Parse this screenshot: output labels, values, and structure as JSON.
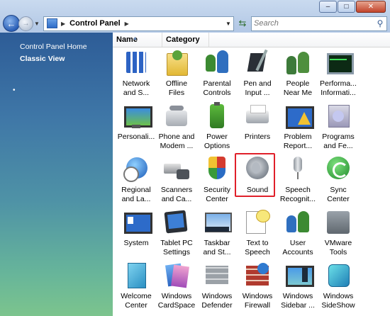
{
  "window": {
    "min_icon": "minimize-icon",
    "max_icon": "maximize-icon",
    "close_icon": "close-icon"
  },
  "nav": {
    "address_text": "Control Panel",
    "search_placeholder": "Search"
  },
  "left_pane": {
    "home_link": "Control Panel Home",
    "classic_view_link": "Classic View"
  },
  "columns": {
    "name": "Name",
    "category": "Category"
  },
  "items": [
    {
      "label": "Network\nand S...",
      "icon": "network-icon"
    },
    {
      "label": "Offline\nFiles",
      "icon": "offline-files-icon"
    },
    {
      "label": "Parental\nControls",
      "icon": "parental-controls-icon"
    },
    {
      "label": "Pen and\nInput ...",
      "icon": "pen-input-icon"
    },
    {
      "label": "People\nNear Me",
      "icon": "people-near-me-icon"
    },
    {
      "label": "Performa...\nInformati...",
      "icon": "performance-icon"
    },
    {
      "label": "Personali...",
      "icon": "personalization-icon"
    },
    {
      "label": "Phone and\nModem ...",
      "icon": "phone-modem-icon"
    },
    {
      "label": "Power\nOptions",
      "icon": "power-options-icon"
    },
    {
      "label": "Printers",
      "icon": "printers-icon"
    },
    {
      "label": "Problem\nReport...",
      "icon": "problem-reports-icon"
    },
    {
      "label": "Programs\nand Fe...",
      "icon": "programs-features-icon"
    },
    {
      "label": "Regional\nand La...",
      "icon": "regional-language-icon"
    },
    {
      "label": "Scanners\nand Ca...",
      "icon": "scanners-cameras-icon"
    },
    {
      "label": "Security\nCenter",
      "icon": "security-center-icon"
    },
    {
      "label": "Sound",
      "icon": "sound-icon"
    },
    {
      "label": "Speech\nRecognit...",
      "icon": "speech-recognition-icon"
    },
    {
      "label": "Sync\nCenter",
      "icon": "sync-center-icon"
    },
    {
      "label": "System",
      "icon": "system-icon"
    },
    {
      "label": "Tablet PC\nSettings",
      "icon": "tablet-pc-icon"
    },
    {
      "label": "Taskbar\nand St...",
      "icon": "taskbar-start-icon"
    },
    {
      "label": "Text to\nSpeech",
      "icon": "text-to-speech-icon"
    },
    {
      "label": "User\nAccounts",
      "icon": "user-accounts-icon"
    },
    {
      "label": "VMware\nTools",
      "icon": "vmware-tools-icon"
    },
    {
      "label": "Welcome\nCenter",
      "icon": "welcome-center-icon"
    },
    {
      "label": "Windows\nCardSpace",
      "icon": "cardspace-icon"
    },
    {
      "label": "Windows\nDefender",
      "icon": "defender-icon"
    },
    {
      "label": "Windows\nFirewall",
      "icon": "firewall-icon"
    },
    {
      "label": "Windows\nSidebar ...",
      "icon": "sidebar-icon"
    },
    {
      "label": "Windows\nSideShow",
      "icon": "sideshow-icon"
    }
  ],
  "selected_item": "Sound",
  "colors": {
    "highlight": "#e0202a",
    "left_pane_top": "#2d5c97",
    "left_pane_bottom": "#7cc48d"
  }
}
